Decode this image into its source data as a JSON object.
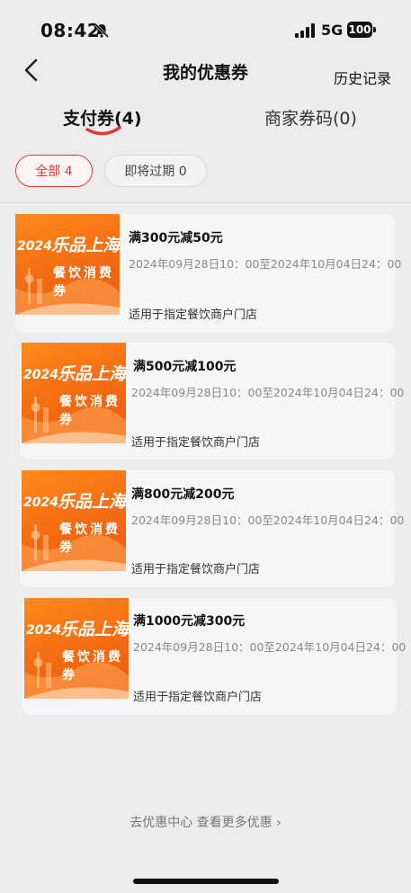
{
  "status_bar": {
    "time": "08:42",
    "network": "5G",
    "battery": "100"
  },
  "nav": {
    "title": "我的优惠券",
    "history": "历史记录"
  },
  "tabs": [
    {
      "label": "支付券(4)",
      "active": true
    },
    {
      "label": "商家券码(0)",
      "active": false
    }
  ],
  "filters": [
    {
      "label": "全部",
      "count": "4",
      "active": true
    },
    {
      "label": "即将过期",
      "count": "0",
      "active": false
    }
  ],
  "coupon_image": {
    "year": "2024",
    "brand": "乐品上海",
    "subtitle": "餐饮消费券"
  },
  "coupons": [
    {
      "title": "满300元减50元",
      "validity": "2024年09月28日10：00至2024年10月04日24：00",
      "scope": "适用于指定餐饮商户门店"
    },
    {
      "title": "满500元减100元",
      "validity": "2024年09月28日10：00至2024年10月04日24：00",
      "scope": "适用于指定餐饮商户门店"
    },
    {
      "title": "满800元减200元",
      "validity": "2024年09月28日10：00至2024年10月04日24：00",
      "scope": "适用于指定餐饮商户门店"
    },
    {
      "title": "满1000元减300元",
      "validity": "2024年09月28日10：00至2024年10月04日24：00",
      "scope": "适用于指定餐饮商户门店"
    }
  ],
  "footer": {
    "link_text": "去优惠中心 查看更多优惠",
    "chevron": "›"
  },
  "colors": {
    "accent": "#e0392f",
    "coupon_orange": "#f36a12",
    "background": "#ececec"
  }
}
